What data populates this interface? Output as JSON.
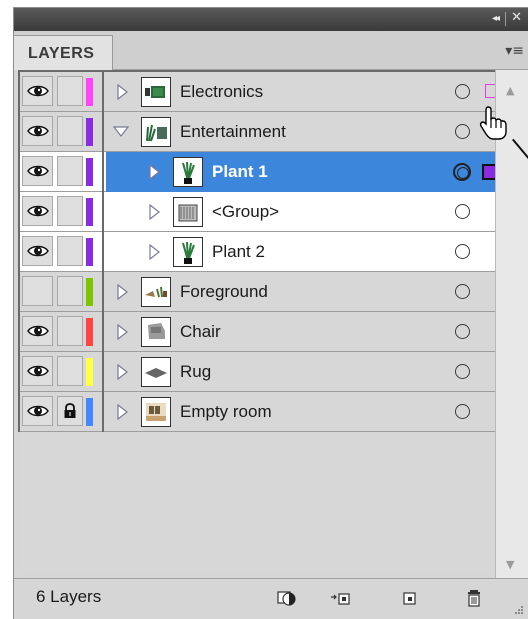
{
  "panel": {
    "tab_label": "LAYERS",
    "collapse_glyph": "◂◂",
    "close_glyph": "✕",
    "menu_glyph": "▾≡"
  },
  "layers": [
    {
      "name": "Electronics",
      "visible": true,
      "locked": false,
      "color": "#ff44ff",
      "level": 0,
      "expanded": false,
      "selected": false,
      "has_selection": "outline"
    },
    {
      "name": "Entertainment",
      "visible": true,
      "locked": false,
      "color": "#8a2be2",
      "level": 0,
      "expanded": true,
      "selected": false,
      "has_selection": "none"
    },
    {
      "name": "Plant 1",
      "visible": true,
      "locked": false,
      "color": "#8a2be2",
      "level": 1,
      "expanded": false,
      "selected": true,
      "has_selection": "filled"
    },
    {
      "name": "<Group>",
      "visible": true,
      "locked": false,
      "color": "#8a2be2",
      "level": 1,
      "expanded": false,
      "selected": false,
      "has_selection": "none"
    },
    {
      "name": "Plant 2",
      "visible": true,
      "locked": false,
      "color": "#8a2be2",
      "level": 1,
      "expanded": false,
      "selected": false,
      "has_selection": "none"
    },
    {
      "name": "Foreground",
      "visible": false,
      "locked": false,
      "color": "#7fc400",
      "level": 0,
      "expanded": false,
      "selected": false,
      "has_selection": "none"
    },
    {
      "name": "Chair",
      "visible": true,
      "locked": false,
      "color": "#ff4444",
      "level": 0,
      "expanded": false,
      "selected": false,
      "has_selection": "none"
    },
    {
      "name": "Rug",
      "visible": true,
      "locked": false,
      "color": "#ffff44",
      "level": 0,
      "expanded": false,
      "selected": false,
      "has_selection": "none"
    },
    {
      "name": "Empty room",
      "visible": true,
      "locked": true,
      "color": "#4488ff",
      "level": 0,
      "expanded": false,
      "selected": false,
      "has_selection": "none"
    }
  ],
  "footer": {
    "layer_count": "6 Layers"
  }
}
